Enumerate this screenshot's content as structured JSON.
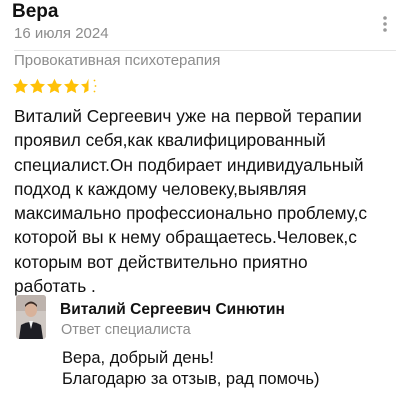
{
  "review": {
    "author": "Вера",
    "date": "16 июля 2024",
    "service": "Провокативная психотерапия",
    "rating": 4.5,
    "rating_max": 5,
    "star_color": "#ffc107",
    "text": "Виталий Сергеевич уже на первой терапии\nпроявил себя,как квалифицированный\nспециалист.Он подбирает индивидуальный\nподход к каждому человеку,выявляя\nмаксимально профессионально проблему,с\nкоторой вы к нему обращаетесь.Человек,с\nкоторым вот действительно приятно\nработать ."
  },
  "response": {
    "specialist_name": "Виталий Сергеевич Синютин",
    "role": "Ответ специалиста",
    "text": "Вера, добрый день!\nБлагодарю за отзыв, рад помочь)"
  },
  "icons": {
    "menu": "more-vertical-icon",
    "star": "star-icon"
  }
}
